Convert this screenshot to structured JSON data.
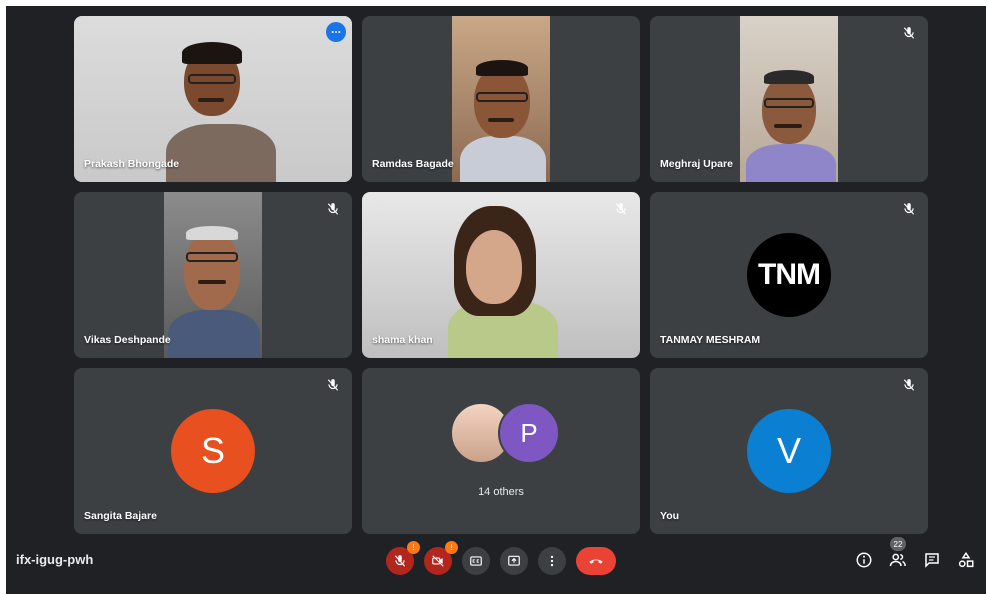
{
  "meeting": {
    "code": "ifx-igug-pwh"
  },
  "participants": [
    {
      "name": "Prakash Bhongade"
    },
    {
      "name": "Ramdas Bagade"
    },
    {
      "name": "Meghraj Upare"
    },
    {
      "name": "Vikas Deshpande"
    },
    {
      "name": "shama khan"
    },
    {
      "name": "TANMAY MESHRAM",
      "logo_text": "TNM"
    },
    {
      "name": "Sangita Bajare",
      "initial": "S",
      "color": "#e8501f"
    },
    {
      "others_label": "14 others",
      "initial": "P",
      "color": "#7e57c2"
    },
    {
      "name": "You",
      "initial": "V",
      "color": "#0b7fd1"
    }
  ],
  "controls": {
    "mic_badge": "!",
    "camera_badge": "!"
  },
  "side": {
    "people_count": "22"
  },
  "colors": {
    "end_call": "#ea4335",
    "accent": "#1a73e8"
  }
}
